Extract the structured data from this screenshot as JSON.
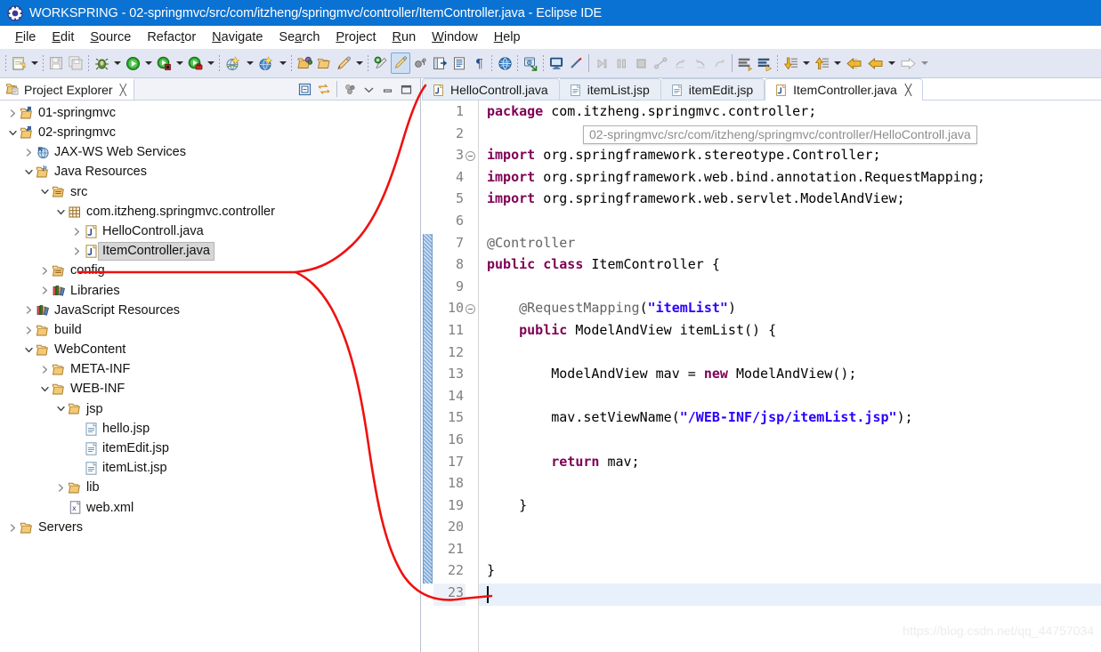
{
  "window": {
    "icon": "eclipse-icon",
    "title": "WORKSPRING - 02-springmvc/src/com/itzheng/springmvc/controller/ItemController.java - Eclipse IDE"
  },
  "menubar": {
    "items": [
      {
        "label": "File",
        "mnemonic": "F"
      },
      {
        "label": "Edit",
        "mnemonic": "E"
      },
      {
        "label": "Source",
        "mnemonic": "S"
      },
      {
        "label": "Refactor",
        "mnemonic": "t"
      },
      {
        "label": "Navigate",
        "mnemonic": "N"
      },
      {
        "label": "Search",
        "mnemonic": "a"
      },
      {
        "label": "Project",
        "mnemonic": "P"
      },
      {
        "label": "Run",
        "mnemonic": "R"
      },
      {
        "label": "Window",
        "mnemonic": "W"
      },
      {
        "label": "Help",
        "mnemonic": "H"
      }
    ]
  },
  "toolbar": {
    "groups": [
      {
        "buttons": [
          "new-wizard-icon"
        ],
        "arrows": [
          true
        ]
      },
      {
        "buttons": [
          "save-icon",
          "save-all-icon"
        ],
        "arrows": [
          false,
          false
        ]
      },
      {
        "buttons": [
          "debug-icon"
        ],
        "arrows": [
          true
        ]
      },
      {
        "buttons": [
          "run-icon"
        ],
        "arrows": [
          true
        ]
      },
      {
        "buttons": [
          "run-external-tools-icon"
        ],
        "arrows": [
          true
        ]
      },
      {
        "buttons": [
          "coverage-icon"
        ],
        "arrows": [
          true
        ]
      },
      {
        "buttons": [
          "new-dynamic-web-project-icon"
        ],
        "arrows": [
          true
        ]
      },
      {
        "buttons": [
          "new-server-icon"
        ],
        "arrows": [
          true
        ]
      },
      {
        "buttons": [
          "open-type-icon",
          "open-task-icon",
          "edit-icon"
        ],
        "arrows": [
          false,
          false,
          true
        ]
      },
      {
        "buttons": [
          "search-icon",
          "toggle-mark-occurrences-icon",
          "skip-breakpoints-icon",
          "open-perspective-icon",
          "show-view-icon",
          "pilcrow-icon"
        ]
      },
      {
        "buttons": [
          "web-browser-icon",
          "external-browser-icon",
          "console-icon",
          "cancel-icon"
        ]
      },
      {
        "buttons": [
          "step-into-icon",
          "step-over-icon",
          "terminate-icon",
          "disconnect-icon",
          "step-return-icon",
          "resume-icon",
          "restart-icon"
        ]
      },
      {
        "buttons": [
          "next-annotation-icon",
          "previous-annotation-icon"
        ]
      },
      {
        "buttons": [
          "down-arrow-icon"
        ],
        "arrows": [
          true
        ]
      },
      {
        "buttons": [
          "up-arrow-icon"
        ],
        "arrows": [
          true
        ]
      },
      {
        "buttons": [
          "back-icon",
          "back-history-icon"
        ],
        "arrows": [
          false,
          true
        ]
      },
      {
        "buttons": [
          "forward-icon"
        ],
        "arrows": [
          true
        ]
      }
    ]
  },
  "explorer": {
    "tab": {
      "icon": "project-explorer-icon",
      "label": "Project Explorer",
      "close": "╳"
    },
    "view_tools": [
      "collapse-all-icon",
      "link-with-editor-icon",
      "view-menu-filters-icon",
      "view-menu-icon",
      "minimize-icon",
      "maximize-icon"
    ],
    "tree": [
      {
        "label": "01-springmvc",
        "depth": 0,
        "twisty": "collapsed",
        "icon": "project-icon",
        "selected": false
      },
      {
        "label": "02-springmvc",
        "depth": 0,
        "twisty": "expanded",
        "icon": "project-icon",
        "selected": false
      },
      {
        "label": "JAX-WS Web Services",
        "depth": 1,
        "twisty": "collapsed",
        "icon": "jaxws-icon",
        "selected": false
      },
      {
        "label": "Java Resources",
        "depth": 1,
        "twisty": "expanded",
        "icon": "java-resources-icon",
        "selected": false
      },
      {
        "label": "src",
        "depth": 2,
        "twisty": "expanded",
        "icon": "source-folder-icon",
        "selected": false
      },
      {
        "label": "com.itzheng.springmvc.controller",
        "depth": 3,
        "twisty": "expanded",
        "icon": "package-icon",
        "selected": false
      },
      {
        "label": "HelloControll.java",
        "depth": 4,
        "twisty": "collapsed",
        "icon": "java-file-icon",
        "selected": false
      },
      {
        "label": "ItemController.java",
        "depth": 4,
        "twisty": "collapsed",
        "icon": "java-file-icon",
        "selected": true
      },
      {
        "label": "config",
        "depth": 2,
        "twisty": "collapsed",
        "icon": "source-folder-icon",
        "selected": false
      },
      {
        "label": "Libraries",
        "depth": 2,
        "twisty": "collapsed",
        "icon": "libraries-icon",
        "selected": false
      },
      {
        "label": "JavaScript Resources",
        "depth": 1,
        "twisty": "collapsed",
        "icon": "libraries-icon",
        "selected": false
      },
      {
        "label": "build",
        "depth": 1,
        "twisty": "collapsed",
        "icon": "folder-icon",
        "selected": false
      },
      {
        "label": "WebContent",
        "depth": 1,
        "twisty": "expanded",
        "icon": "folder-icon",
        "selected": false
      },
      {
        "label": "META-INF",
        "depth": 2,
        "twisty": "collapsed",
        "icon": "folder-icon",
        "selected": false
      },
      {
        "label": "WEB-INF",
        "depth": 2,
        "twisty": "expanded",
        "icon": "folder-icon",
        "selected": false
      },
      {
        "label": "jsp",
        "depth": 3,
        "twisty": "expanded",
        "icon": "folder-icon",
        "selected": false
      },
      {
        "label": "hello.jsp",
        "depth": 4,
        "twisty": "none",
        "icon": "jsp-file-icon",
        "selected": false
      },
      {
        "label": "itemEdit.jsp",
        "depth": 4,
        "twisty": "none",
        "icon": "jsp-file-icon",
        "selected": false
      },
      {
        "label": "itemList.jsp",
        "depth": 4,
        "twisty": "none",
        "icon": "jsp-file-icon",
        "selected": false
      },
      {
        "label": "lib",
        "depth": 3,
        "twisty": "collapsed",
        "icon": "folder-icon",
        "selected": false
      },
      {
        "label": "web.xml",
        "depth": 3,
        "twisty": "none",
        "icon": "xml-file-icon",
        "selected": false
      },
      {
        "label": "Servers",
        "depth": 0,
        "twisty": "collapsed",
        "icon": "folder-icon",
        "selected": false
      }
    ]
  },
  "editor": {
    "tabs": [
      {
        "label": "HelloControll.java",
        "icon": "java-file-icon",
        "active": false,
        "closable": false
      },
      {
        "label": "itemList.jsp",
        "icon": "jsp-file-icon",
        "active": false,
        "closable": false
      },
      {
        "label": "itemEdit.jsp",
        "icon": "jsp-file-icon",
        "active": false,
        "closable": false
      },
      {
        "label": "ItemController.java",
        "icon": "java-file-icon",
        "active": true,
        "closable": true,
        "close": "╳"
      }
    ],
    "tooltip": "02-springmvc/src/com/itzheng/springmvc/controller/HelloControll.java",
    "current_line": 23,
    "lines": [
      {
        "n": 1,
        "fold": false,
        "tokens": [
          {
            "t": "package ",
            "c": "kw"
          },
          {
            "t": "com.itzheng.springmvc.controller;",
            "c": "plain"
          }
        ]
      },
      {
        "n": 2,
        "fold": false,
        "tokens": []
      },
      {
        "n": 3,
        "fold": true,
        "tokens": [
          {
            "t": "import ",
            "c": "kw"
          },
          {
            "t": "org.springframework.stereotype.Controller;",
            "c": "plain"
          }
        ]
      },
      {
        "n": 4,
        "fold": false,
        "tokens": [
          {
            "t": "import ",
            "c": "kw"
          },
          {
            "t": "org.springframework.web.bind.annotation.RequestMapping;",
            "c": "plain"
          }
        ]
      },
      {
        "n": 5,
        "fold": false,
        "tokens": [
          {
            "t": "import ",
            "c": "kw"
          },
          {
            "t": "org.springframework.web.servlet.ModelAndView;",
            "c": "plain"
          }
        ]
      },
      {
        "n": 6,
        "fold": false,
        "tokens": []
      },
      {
        "n": 7,
        "fold": false,
        "tokens": [
          {
            "t": "@Controller",
            "c": "ann"
          }
        ]
      },
      {
        "n": 8,
        "fold": false,
        "tokens": [
          {
            "t": "public class ",
            "c": "kw"
          },
          {
            "t": "ItemController {",
            "c": "plain"
          }
        ]
      },
      {
        "n": 9,
        "fold": false,
        "tokens": []
      },
      {
        "n": 10,
        "fold": true,
        "tokens": [
          {
            "t": "    ",
            "c": "plain"
          },
          {
            "t": "@RequestMapping",
            "c": "ann"
          },
          {
            "t": "(",
            "c": "plain"
          },
          {
            "t": "\"itemList\"",
            "c": "str"
          },
          {
            "t": ")",
            "c": "plain"
          }
        ]
      },
      {
        "n": 11,
        "fold": false,
        "tokens": [
          {
            "t": "    ",
            "c": "plain"
          },
          {
            "t": "public ",
            "c": "kw"
          },
          {
            "t": "ModelAndView itemList() {",
            "c": "plain"
          }
        ]
      },
      {
        "n": 12,
        "fold": false,
        "tokens": []
      },
      {
        "n": 13,
        "fold": false,
        "tokens": [
          {
            "t": "        ModelAndView mav = ",
            "c": "plain"
          },
          {
            "t": "new ",
            "c": "kw"
          },
          {
            "t": "ModelAndView();",
            "c": "plain"
          }
        ]
      },
      {
        "n": 14,
        "fold": false,
        "tokens": []
      },
      {
        "n": 15,
        "fold": false,
        "tokens": [
          {
            "t": "        mav.setViewName(",
            "c": "plain"
          },
          {
            "t": "\"/WEB-INF/jsp/itemList.jsp\"",
            "c": "str"
          },
          {
            "t": ");",
            "c": "plain"
          }
        ]
      },
      {
        "n": 16,
        "fold": false,
        "tokens": []
      },
      {
        "n": 17,
        "fold": false,
        "tokens": [
          {
            "t": "        ",
            "c": "plain"
          },
          {
            "t": "return ",
            "c": "kw"
          },
          {
            "t": "mav;",
            "c": "plain"
          }
        ]
      },
      {
        "n": 18,
        "fold": false,
        "tokens": []
      },
      {
        "n": 19,
        "fold": false,
        "tokens": [
          {
            "t": "    }",
            "c": "plain"
          }
        ]
      },
      {
        "n": 20,
        "fold": false,
        "tokens": []
      },
      {
        "n": 21,
        "fold": false,
        "tokens": []
      },
      {
        "n": 22,
        "fold": false,
        "tokens": [
          {
            "t": "}",
            "c": "plain"
          }
        ]
      },
      {
        "n": 23,
        "fold": false,
        "tokens": []
      }
    ]
  },
  "annotation": {
    "color": "#ee1111",
    "shape": "red-handdrawn-bracket-curve"
  },
  "watermark": "https://blog.csdn.net/qq_44757034",
  "colors": {
    "titlebar": "#0a72d2",
    "toolbar": "#e3e7f3",
    "selection": "#d6d6d6",
    "keyword": "#7f0055",
    "string": "#2a00ff",
    "annotation_text": "#646464",
    "line_number": "#808080",
    "current_line": "#e8f0fb"
  }
}
